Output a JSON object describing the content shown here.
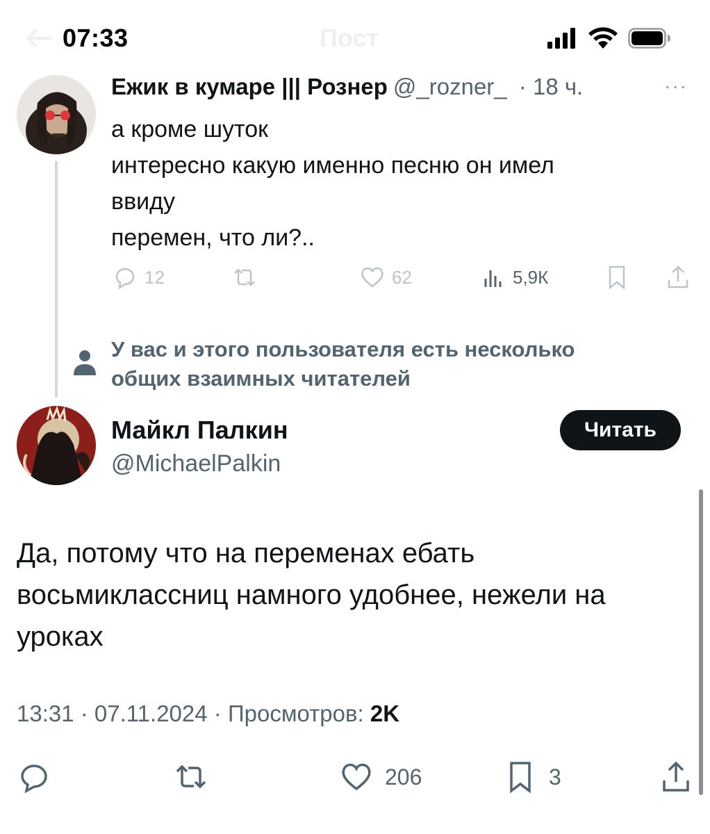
{
  "status_bar": {
    "time": "07:33",
    "title": "Пост"
  },
  "parent_tweet": {
    "author_name": "Ежик в кумаре ||| Рознер",
    "handle": "@_rozner_",
    "time_ago": "· 18 ч.",
    "more": "···",
    "lines": [
      "а кроме шуток",
      "интересно какую именно песню он имел",
      "ввиду",
      "перемен, что ли?.."
    ],
    "actions": {
      "replies": "12",
      "reposts": "",
      "likes": "62",
      "views": "5,9К"
    }
  },
  "mutual_notice": {
    "line1": "У вас и этого пользователя есть несколько",
    "line2": "общих взаимных читателей"
  },
  "main_tweet": {
    "author_name": "Майкл Палкин",
    "handle": "@MichaelPalkin",
    "follow_label": "Читать",
    "lines": [
      "Да, потому что на переменах ебать",
      "восьмиклассниц намного удобнее, нежели на",
      "уроках"
    ],
    "meta_prefix": "13:31 · 07.11.2024 · Просмотров: ",
    "meta_views": "2K",
    "actions": {
      "likes": "206",
      "bookmarks": "3"
    }
  },
  "colors": {
    "text": "#0f1419",
    "secondary": "#536471",
    "faded_icon": "#b9c4cd",
    "thread_line": "#cfd9de",
    "follow_bg": "#0f1419"
  },
  "icons": {
    "signal": "signal-icon",
    "wifi": "wifi-icon",
    "battery": "battery-icon",
    "reply": "reply-icon",
    "repost": "repost-icon",
    "like": "heart-icon",
    "views": "views-icon",
    "bookmark": "bookmark-icon",
    "share": "share-icon",
    "person": "person-icon"
  }
}
